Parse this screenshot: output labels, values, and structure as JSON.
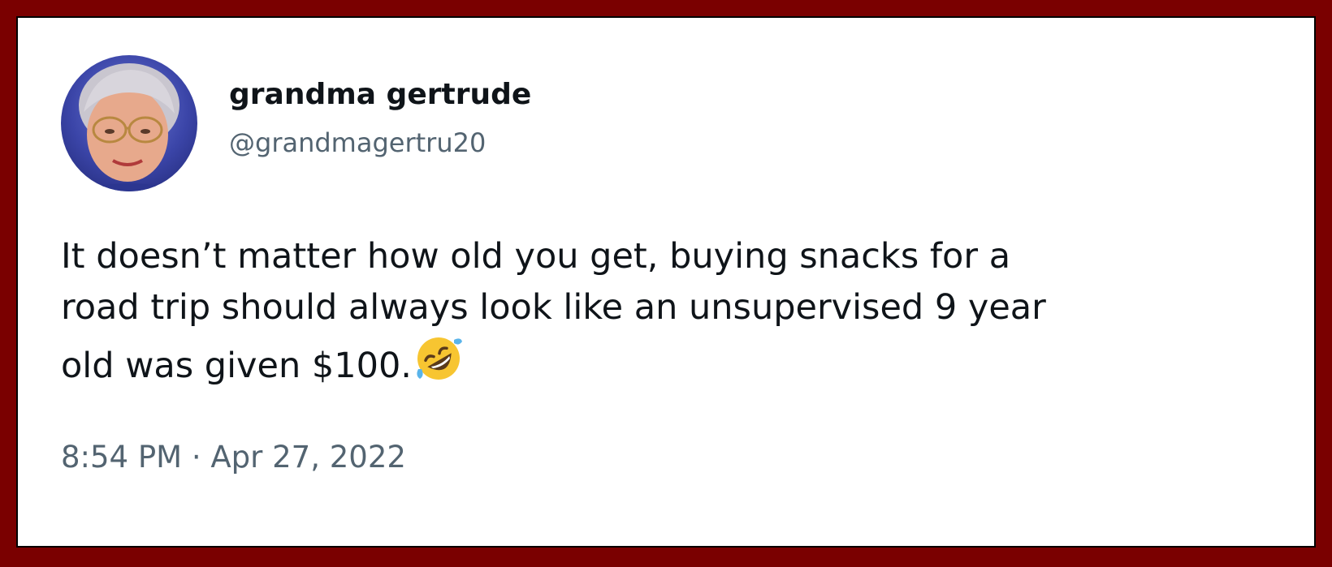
{
  "tweet": {
    "author": {
      "display_name": "grandma gertrude",
      "handle": "@grandmagertru20",
      "avatar_icon": "person-portrait-avatar"
    },
    "text_lines": [
      "It doesn’t matter how old you get, buying snacks for a",
      "road trip should always look like an unsupervised 9 year",
      "old was given $100."
    ],
    "emoji": "rolling-on-floor-laughing-emoji",
    "timestamp": "8:54 PM · Apr 27, 2022"
  },
  "colors": {
    "frame_border": "#7a0000",
    "background": "#ffffff",
    "primary_text": "#0f1419",
    "secondary_text": "#536471"
  }
}
